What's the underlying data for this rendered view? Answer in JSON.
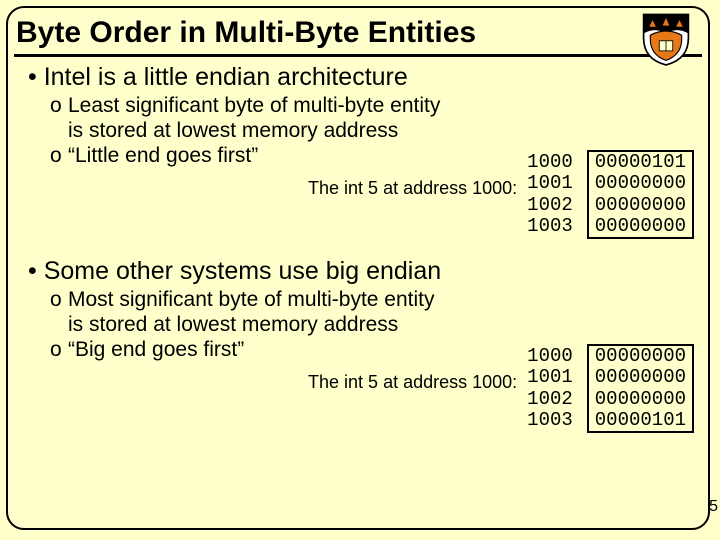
{
  "title": "Byte Order in Multi-Byte Entities",
  "page_number": "5",
  "section1": {
    "bullet": "Intel is a little endian architecture",
    "sub1a": "Least significant byte of multi-byte entity",
    "sub1b": "is stored at lowest memory address",
    "sub2": "“Little end goes first”",
    "caption": "The int 5 at address 1000:",
    "addrs": [
      "1000",
      "1001",
      "1002",
      "1003"
    ],
    "bytes": [
      "00000101",
      "00000000",
      "00000000",
      "00000000"
    ]
  },
  "section2": {
    "bullet": "Some other systems use big endian",
    "sub1a": "Most significant byte of multi-byte entity",
    "sub1b": "is stored at lowest memory address",
    "sub2": "“Big end goes first”",
    "caption": "The int 5 at address 1000:",
    "addrs": [
      "1000",
      "1001",
      "1002",
      "1003"
    ],
    "bytes": [
      "00000000",
      "00000000",
      "00000000",
      "00000101"
    ]
  }
}
